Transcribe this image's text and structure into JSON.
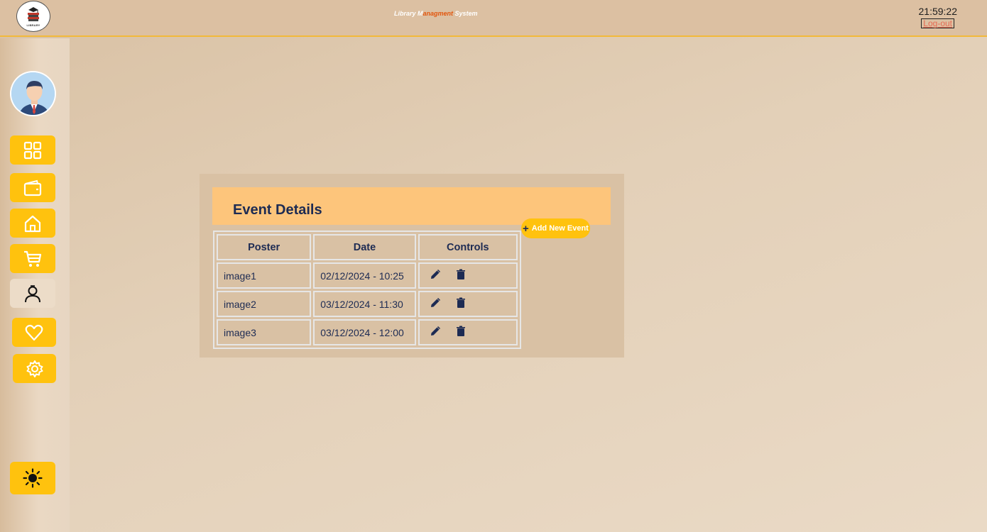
{
  "header": {
    "title_prefix": "Library M",
    "title_accent": "anagment",
    "title_suffix": " System",
    "clock": "21:59:22",
    "logout_label": "Log-out",
    "logo_caption": "LIBRARY"
  },
  "sidebar": {
    "items": [
      {
        "name": "dashboard",
        "icon": "grid-icon"
      },
      {
        "name": "wallet",
        "icon": "wallet-icon"
      },
      {
        "name": "home",
        "icon": "home-icon"
      },
      {
        "name": "cart",
        "icon": "cart-icon"
      },
      {
        "name": "user",
        "icon": "user-icon",
        "active": true
      },
      {
        "name": "favorites",
        "icon": "heart-icon"
      },
      {
        "name": "settings",
        "icon": "gear-icon"
      }
    ],
    "theme_toggle_icon": "sun-icon"
  },
  "panel": {
    "title": "Event Details",
    "add_label": "Add New Event",
    "columns": [
      "Poster",
      "Date",
      "Controls"
    ],
    "rows": [
      {
        "poster": "image1",
        "date": "02/12/2024 - 10:25"
      },
      {
        "poster": "image2",
        "date": "03/12/2024 - 11:30"
      },
      {
        "poster": "image3",
        "date": "03/12/2024 - 12:00"
      }
    ]
  },
  "colors": {
    "accent": "#ffc20e",
    "header_band": "#fdc57b",
    "title_accent": "#e2560e",
    "text_dark": "#1d2b53"
  }
}
